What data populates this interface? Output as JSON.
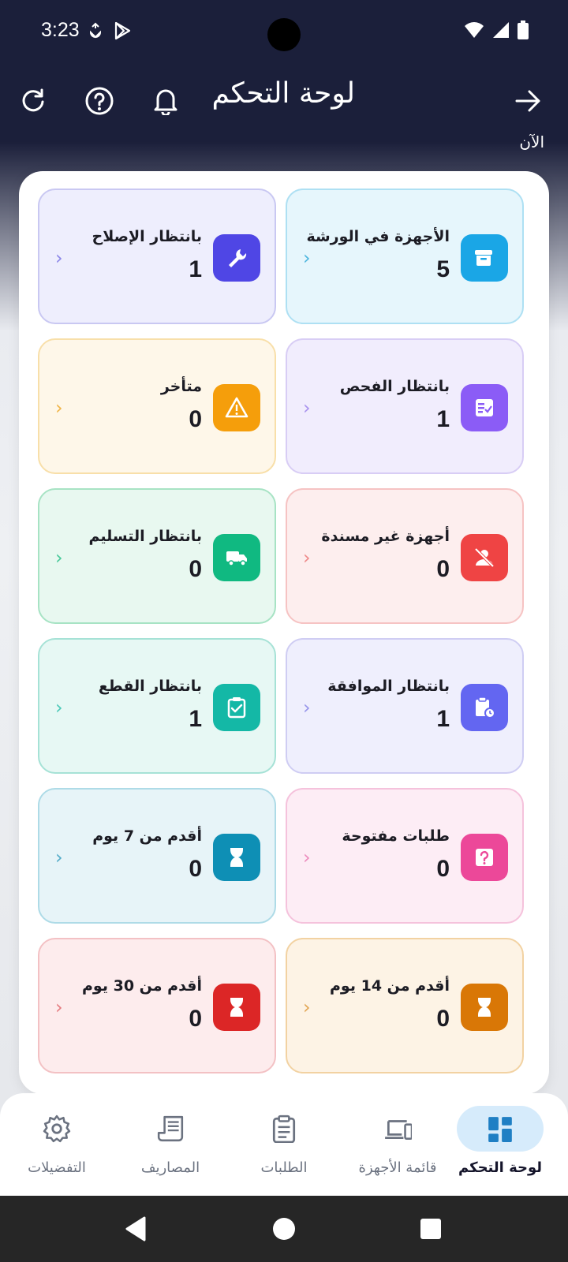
{
  "status": {
    "time": "3:23"
  },
  "header": {
    "title": "لوحة التحكم",
    "scroll_hint": "الآن"
  },
  "cards": [
    {
      "label": "الأجهزة في الورشة",
      "count": "5",
      "icon": "archive-icon",
      "bg": "#e6f6fc",
      "border": "#aee0f3",
      "icon_bg": "#1aa6e6",
      "chev": "#4fb6de"
    },
    {
      "label": "بانتظار الإصلاح",
      "count": "1",
      "icon": "wrench-icon",
      "bg": "#eeeefd",
      "border": "#c9c8f2",
      "icon_bg": "#4f46e5",
      "chev": "#8b86e8"
    },
    {
      "label": "بانتظار الفحص",
      "count": "1",
      "icon": "checklist-icon",
      "bg": "#f1edfd",
      "border": "#d8cdf5",
      "icon_bg": "#8b5cf6",
      "chev": "#a993ee"
    },
    {
      "label": "متأخر",
      "count": "0",
      "icon": "warning-icon",
      "bg": "#fef7e9",
      "border": "#f8dfa9",
      "icon_bg": "#f59e0b",
      "chev": "#f0b548"
    },
    {
      "label": "أجهزة غير مسندة",
      "count": "0",
      "icon": "user-off-icon",
      "bg": "#fdeeee",
      "border": "#f6c3c3",
      "icon_bg": "#ef4444",
      "chev": "#ee8a8a"
    },
    {
      "label": "بانتظار التسليم",
      "count": "0",
      "icon": "truck-icon",
      "bg": "#e8f8f0",
      "border": "#a7e3c4",
      "icon_bg": "#10b981",
      "chev": "#49c99a"
    },
    {
      "label": "بانتظار الموافقة",
      "count": "1",
      "icon": "clipboard-clock-icon",
      "bg": "#efeffd",
      "border": "#cfcdf3",
      "icon_bg": "#6366f1",
      "chev": "#9795ea"
    },
    {
      "label": "بانتظار القطع",
      "count": "1",
      "icon": "clipboard-check-icon",
      "bg": "#e7f8f4",
      "border": "#a6e2d6",
      "icon_bg": "#14b8a6",
      "chev": "#4cc9b8"
    },
    {
      "label": "طلبات مفتوحة",
      "count": "0",
      "icon": "question-icon",
      "bg": "#fdedf5",
      "border": "#f5c2dc",
      "icon_bg": "#ec4899",
      "chev": "#ec8cbd"
    },
    {
      "label": "أقدم من 7 يوم",
      "count": "0",
      "icon": "hourglass-icon",
      "bg": "#e7f4f8",
      "border": "#aedbe7",
      "icon_bg": "#0e8fb5",
      "chev": "#53acc9"
    },
    {
      "label": "أقدم من 14 يوم",
      "count": "0",
      "icon": "hourglass-icon",
      "bg": "#fdf3e5",
      "border": "#f2d2a2",
      "icon_bg": "#d97706",
      "chev": "#e2a655"
    },
    {
      "label": "أقدم من 30 يوم",
      "count": "0",
      "icon": "hourglass-icon",
      "bg": "#fdeced",
      "border": "#f3c1c4",
      "icon_bg": "#dc2626",
      "chev": "#e57c80"
    }
  ],
  "nav": [
    {
      "label": "لوحة التحكم",
      "icon": "dashboard-icon",
      "active": true
    },
    {
      "label": "قائمة الأجهزة",
      "icon": "devices-icon",
      "active": false
    },
    {
      "label": "الطلبات",
      "icon": "orders-icon",
      "active": false
    },
    {
      "label": "المصاريف",
      "icon": "receipt-icon",
      "active": false
    },
    {
      "label": "التفضيلات",
      "icon": "gear-icon",
      "active": false
    }
  ]
}
